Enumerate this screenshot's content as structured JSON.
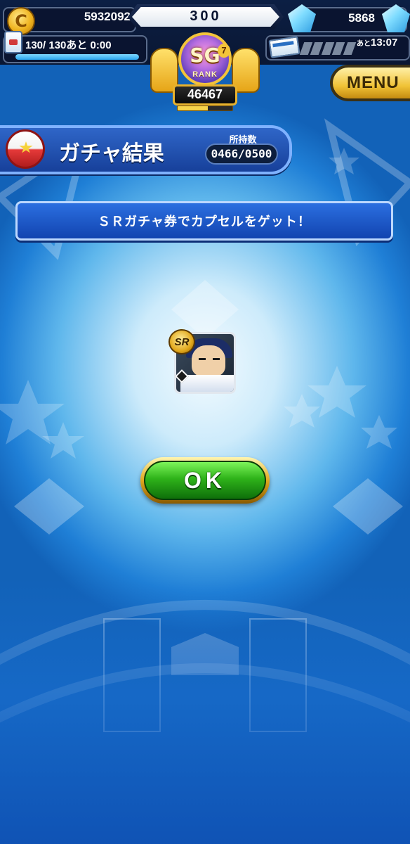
{
  "hud": {
    "coin": {
      "icon": "coin-icon",
      "symbol": "C",
      "value": "5932092"
    },
    "stamina": {
      "text": "130/ 130あと  0:00",
      "fill_percent": 100
    },
    "center_value": "300",
    "gems": {
      "icon": "diamond-icon",
      "value": "5868"
    },
    "ticket": {
      "prefix": "あと",
      "time": "13:07"
    }
  },
  "rank": {
    "letters": "SG",
    "level": "7",
    "label": "RANK",
    "score": "46467",
    "progress_percent": 55
  },
  "menu": {
    "label": "MENU"
  },
  "title": {
    "text": "ガチャ結果",
    "possession_label": "所持数",
    "possession_value": "0466/0500"
  },
  "message": "ＳＲガチャ券でカプセルをゲット！",
  "result": {
    "rarity": "SR"
  },
  "ok_button": {
    "label": "OK"
  },
  "colors": {
    "banner_blue": "#1c4fb8",
    "ok_green": "#2fb31a",
    "gold": "#e0a820"
  }
}
